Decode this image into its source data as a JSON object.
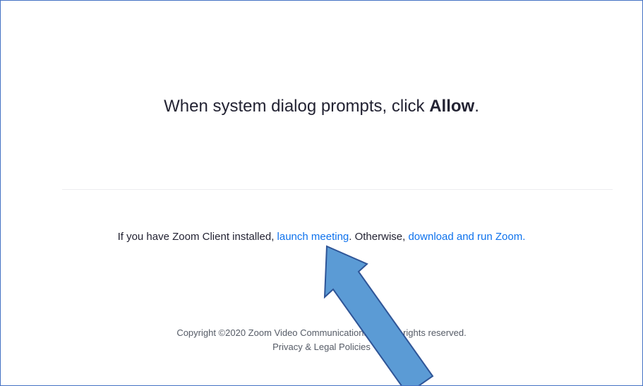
{
  "prompt": {
    "before": "When system dialog prompts, click ",
    "emphasis": "Allow",
    "after": "."
  },
  "launch": {
    "prefix": "If you have Zoom Client installed, ",
    "launch_link": "launch meeting",
    "middle": ". Otherwise, ",
    "download_link": "download and run Zoom."
  },
  "footer": {
    "copyright": "Copyright ©2020 Zoom Video Communications, Inc. All rights reserved.",
    "privacy_link": "Privacy & Legal Policies"
  },
  "annotation": {
    "icon": "arrow-icon",
    "fill": "#5b9bd5",
    "stroke": "#2f5597"
  }
}
